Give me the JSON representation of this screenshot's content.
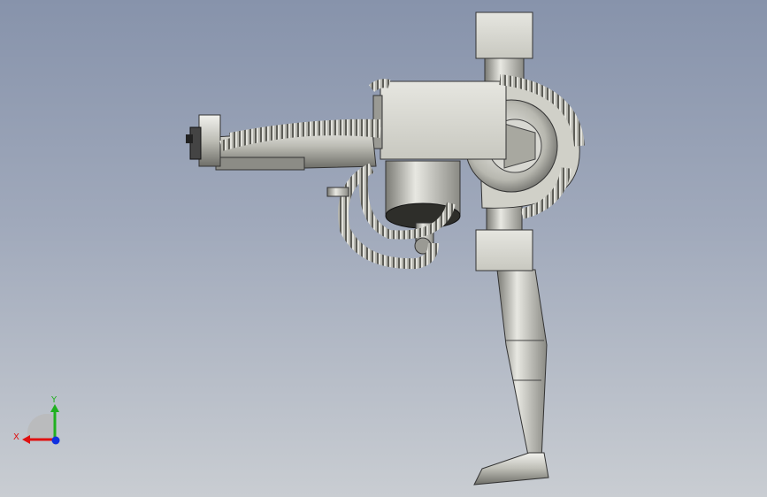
{
  "viewport": {
    "background_top": "#8793ab",
    "background_bottom": "#c9cdd2",
    "model_icon": "robot-arm-3d-model"
  },
  "triad": {
    "x_label": "X",
    "y_label": "Y",
    "x_color": "#e01010",
    "y_color": "#20b020",
    "z_color": "#1030e0"
  }
}
